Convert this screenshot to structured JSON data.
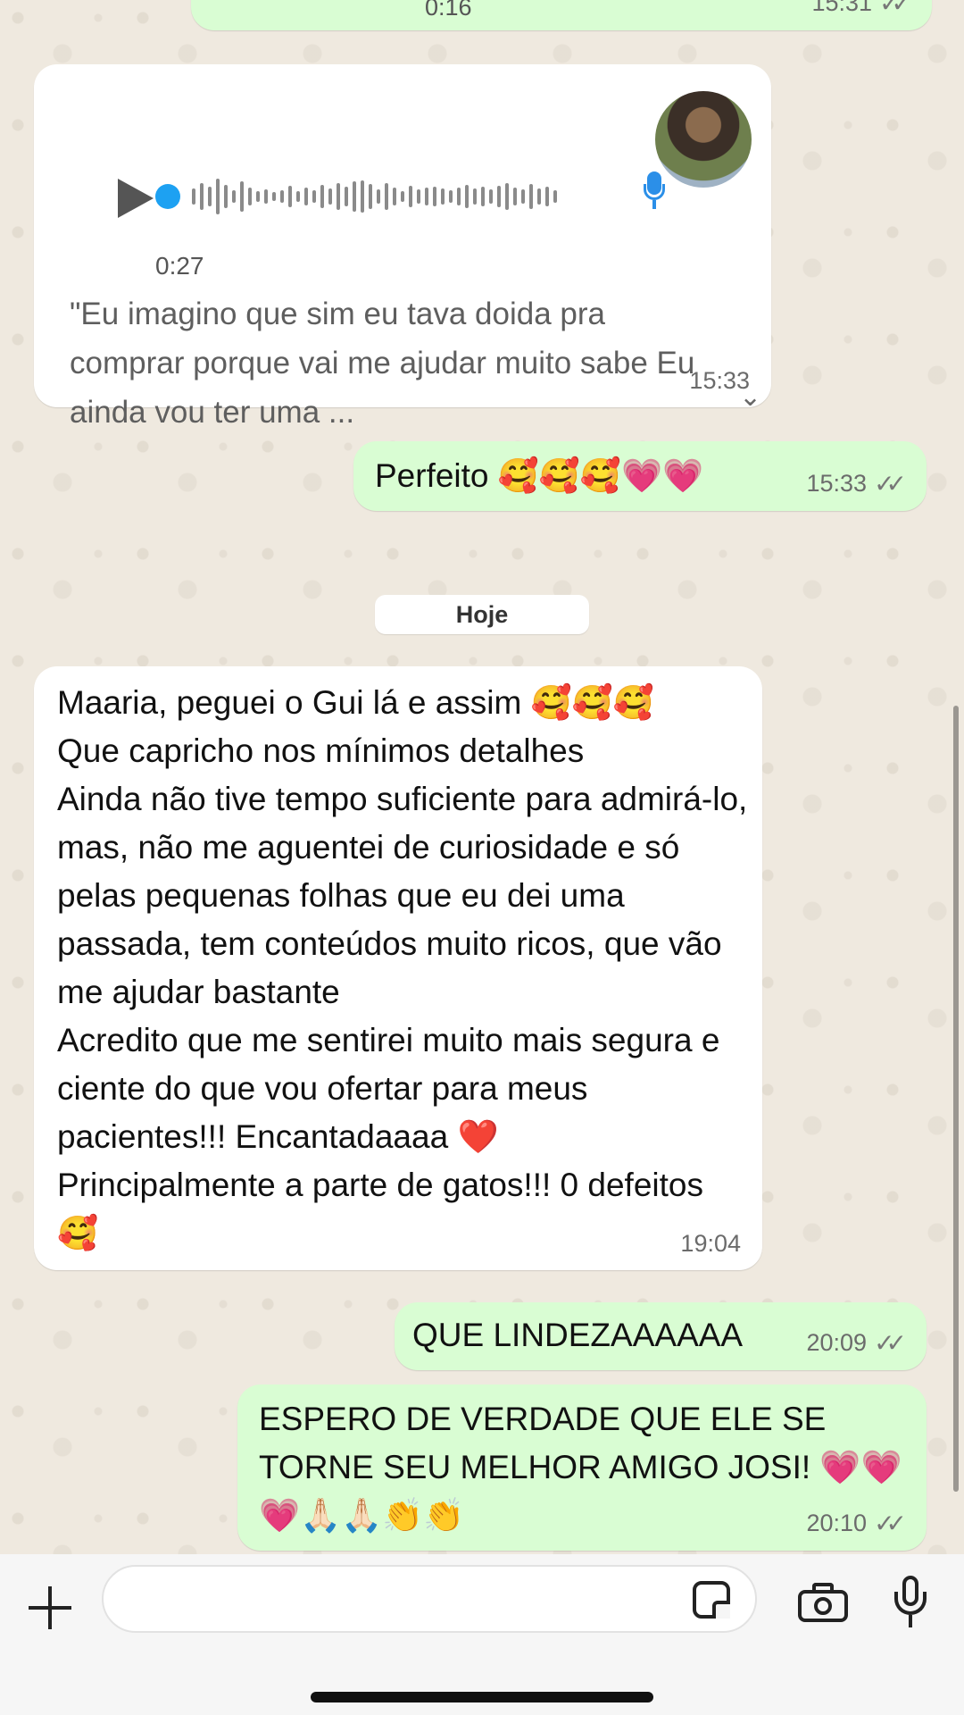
{
  "messages": {
    "top_audio": {
      "duration": "0:16",
      "time": "15:31",
      "ticks": "✓✓"
    },
    "voice": {
      "duration": "0:27",
      "transcript": "\"Eu imagino que sim eu tava doida pra comprar porque vai me ajudar muito sabe Eu ainda vou ter uma ...",
      "time": "15:33",
      "expand_icon": "chevron-down-icon",
      "accent": "#1da1f2"
    },
    "perfeito": {
      "text": "Perfeito 🥰🥰🥰💗💗",
      "time": "15:33",
      "ticks": "✓✓"
    },
    "date_separator": "Hoje",
    "long": {
      "text": "Maaria, peguei o Gui lá e assim 🥰🥰🥰\nQue capricho nos mínimos detalhes\nAinda não tive tempo suficiente para admirá-lo, mas, não me aguentei de curiosidade e só pelas pequenas folhas que eu dei uma passada, tem conteúdos muito ricos, que vão me ajudar bastante\nAcredito que me sentirei muito mais segura e ciente do que vou ofertar para meus pacientes!!! Encantadaaaa ❤️\nPrincipalmente a parte de gatos!!! 0 defeitos 🥰",
      "time": "19:04"
    },
    "lindeza": {
      "text": "QUE LINDEZAAAAAA",
      "time": "20:09",
      "ticks": "✓✓"
    },
    "espero": {
      "text": "ESPERO DE VERDADE QUE ELE SE TORNE SEU MELHOR AMIGO JOSI! 💗💗💗🙏🏻🙏🏻👏👏",
      "time": "20:10",
      "ticks": "✓✓"
    }
  },
  "input_bar": {
    "placeholder": "",
    "icons": [
      "plus-icon",
      "sticker-icon",
      "camera-icon",
      "mic-icon"
    ]
  },
  "colors": {
    "outgoing": "#d9fdd3",
    "incoming": "#ffffff",
    "background": "#efe9df"
  }
}
